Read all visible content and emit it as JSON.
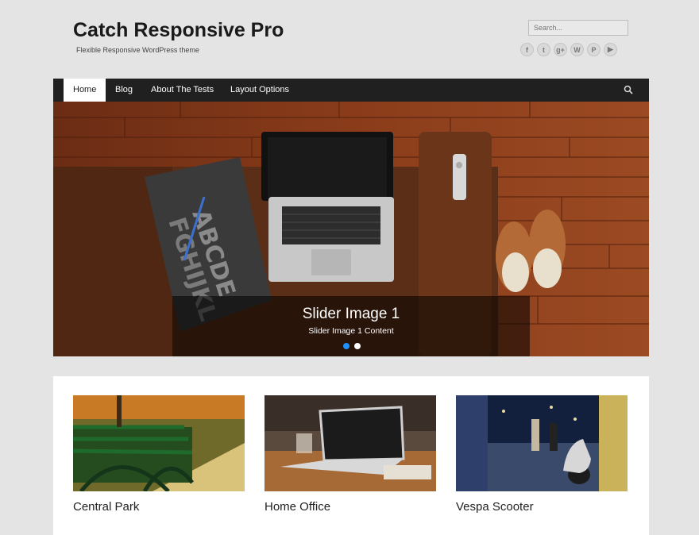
{
  "site": {
    "title": "Catch Responsive Pro",
    "description": "Flexible Responsive WordPress theme"
  },
  "search": {
    "placeholder": "Search..."
  },
  "social_icons": [
    "facebook-icon",
    "twitter-icon",
    "googleplus-icon",
    "wordpress-icon",
    "pinterest-icon",
    "youtube-icon"
  ],
  "nav": {
    "items": [
      {
        "label": "Home",
        "active": true
      },
      {
        "label": "Blog"
      },
      {
        "label": "About The Tests"
      },
      {
        "label": "Layout Options"
      }
    ]
  },
  "slider": {
    "title": "Slider Image 1",
    "content": "Slider Image 1 Content",
    "slide_count": 2,
    "active_index": 0
  },
  "featured": [
    {
      "title": "Central Park"
    },
    {
      "title": "Home Office"
    },
    {
      "title": "Vespa Scooter"
    }
  ],
  "colors": {
    "background": "#e4e4e4",
    "nav_bg": "#202020",
    "active_dot": "#1e90ff"
  }
}
